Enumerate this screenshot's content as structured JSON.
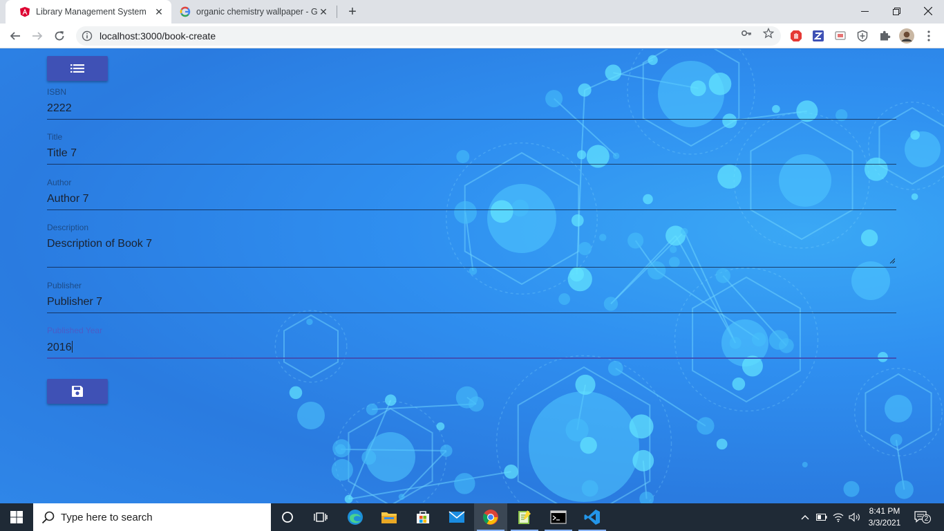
{
  "browser": {
    "tabs": [
      {
        "title": "Library Management System",
        "active": true,
        "favicon": "angular-icon"
      },
      {
        "title": "organic chemistry wallpaper - Go",
        "active": false,
        "favicon": "google-icon"
      }
    ],
    "url": "localhost:3000/book-create"
  },
  "form": {
    "fields": [
      {
        "label": "ISBN",
        "value": "2222"
      },
      {
        "label": "Title",
        "value": "Title 7"
      },
      {
        "label": "Author",
        "value": "Author 7"
      },
      {
        "label": "Description",
        "value": "Description of Book 7"
      },
      {
        "label": "Publisher",
        "value": "Publisher 7"
      },
      {
        "label": "Published Year",
        "value": "2016",
        "focused": true
      }
    ],
    "list_button_icon": "list-icon",
    "save_button_icon": "save-icon"
  },
  "taskbar": {
    "search_placeholder": "Type here to search",
    "time": "8:41 PM",
    "date": "3/3/2021",
    "notification_count": "2"
  },
  "colors": {
    "primary": "#3f51b5",
    "page_background": "#2f8ff0",
    "taskbar": "#1f2a36"
  }
}
